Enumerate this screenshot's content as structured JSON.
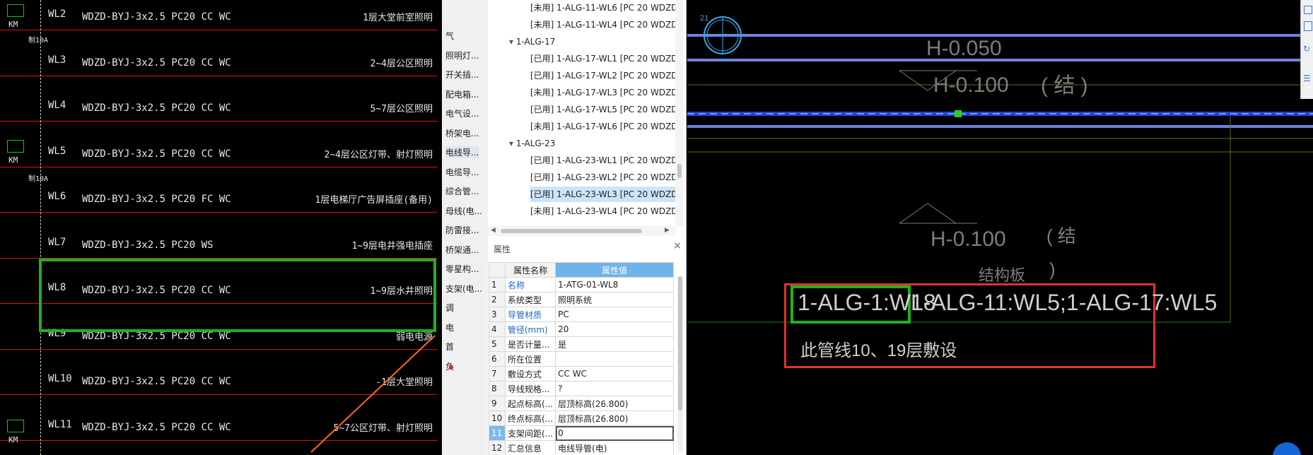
{
  "left_cad": {
    "circuits": [
      {
        "code": "WL2",
        "spec": "WDZD-BYJ-3x2.5 PC20 CC WC",
        "desc": "1层大堂前室照明"
      },
      {
        "code": "WL3",
        "spec": "WDZD-BYJ-3x2.5 PC20 CC WC",
        "desc": "2~4层公区照明"
      },
      {
        "code": "WL4",
        "spec": "WDZD-BYJ-3x2.5 PC20 CC WC",
        "desc": "5~7层公区照明"
      },
      {
        "code": "WL5",
        "spec": "WDZD-BYJ-3x2.5 PC20 CC WC",
        "desc": "2~4层公区灯带、射灯照明"
      },
      {
        "code": "WL6",
        "spec": "WDZD-BYJ-3x2.5 PC20 FC WC",
        "desc": "1层电梯厅广告屏插座(备用)"
      },
      {
        "code": "WL7",
        "spec": "WDZD-BYJ-3x2.5 PC20 WS",
        "desc": "1~9层电井强电插座"
      },
      {
        "code": "WL8",
        "spec": "WDZD-BYJ-3x2.5 PC20 CC WC",
        "desc": "1~9层水井照明"
      },
      {
        "code": "WL9",
        "spec": "WDZD-BYJ-3x2.5 PC20 CC WC",
        "desc": "弱电电源"
      },
      {
        "code": "WL10",
        "spec": "WDZD-BYJ-3x2.5 PC20 CC WC",
        "desc": "-1层大堂照明"
      },
      {
        "code": "WL11",
        "spec": "WDZD-BYJ-3x2.5 PC20 CC WC",
        "desc": "5~7公区灯带、射灯照明"
      }
    ],
    "km_label": "KM",
    "breaker_label": "制10A"
  },
  "categories": [
    "气",
    "照明灯...",
    "开关插...",
    "配电箱...",
    "电气设...",
    "桥架电...",
    "电线导...",
    "电缆导...",
    "综合管...",
    "母线(电...",
    "防雷接...",
    "桥架通...",
    "零星构...",
    "支架(电...",
    "调",
    "电",
    "首",
    "负"
  ],
  "tree": {
    "rows": [
      {
        "text": "[未用] 1-ALG-11-WL6 [PC 20 WDZD",
        "indent": 2
      },
      {
        "text": "[未用] 1-ALG-11-WL4 [PC 20 WDZD",
        "indent": 2
      },
      {
        "text": "1-ALG-17",
        "indent": 1,
        "group": true
      },
      {
        "text": "[已用] 1-ALG-17-WL1 [PC 20 WDZD",
        "indent": 2
      },
      {
        "text": "[已用] 1-ALG-17-WL2 [PC 20 WDZD",
        "indent": 2
      },
      {
        "text": "[未用] 1-ALG-17-WL3 [PC 20 WDZD",
        "indent": 2
      },
      {
        "text": "[已用] 1-ALG-17-WL5 [PC 20 WDZD",
        "indent": 2
      },
      {
        "text": "[未用] 1-ALG-17-WL6 [PC 20 WDZD",
        "indent": 2
      },
      {
        "text": "1-ALG-23",
        "indent": 1,
        "group": true
      },
      {
        "text": "[已用] 1-ALG-23-WL1 [PC 20 WDZD",
        "indent": 2
      },
      {
        "text": "[已用] 1-ALG-23-WL2 [PC 20 WDZD",
        "indent": 2
      },
      {
        "text": "[已用] 1-ALG-23-WL3 [PC 20 WDZD",
        "indent": 2,
        "selected": true
      },
      {
        "text": "[未用] 1-ALG-23-WL4 [PC 20 WDZD",
        "indent": 2
      }
    ]
  },
  "props": {
    "title": "属性",
    "header": [
      "属性名称",
      "属性值"
    ],
    "rows": [
      {
        "n": "1",
        "name": "名称",
        "value": "1-ATG-01-WL8",
        "blue": true
      },
      {
        "n": "2",
        "name": "系统类型",
        "value": "照明系统",
        "blue": false
      },
      {
        "n": "3",
        "name": "导管材质",
        "value": "PC",
        "blue": true
      },
      {
        "n": "4",
        "name": "管径(mm)",
        "value": "20",
        "blue": true
      },
      {
        "n": "5",
        "name": "是否计量...",
        "value": "是",
        "blue": false
      },
      {
        "n": "6",
        "name": "所在位置",
        "value": "",
        "blue": false
      },
      {
        "n": "7",
        "name": "敷设方式",
        "value": "CC WC",
        "blue": false
      },
      {
        "n": "8",
        "name": "导线规格...",
        "value": "?",
        "blue": false
      },
      {
        "n": "9",
        "name": "起点标高(...",
        "value": "层顶标高(26.800)",
        "blue": false
      },
      {
        "n": "10",
        "name": "终点标高(...",
        "value": "层顶标高(26.800)",
        "blue": false
      },
      {
        "n": "11",
        "name": "支架间距(...",
        "value": "0",
        "blue": false
      },
      {
        "n": "12",
        "name": "汇总信息",
        "value": "电线导管(电)",
        "blue": false
      }
    ]
  },
  "right_cad": {
    "axis_label": "21",
    "h1": "H-0.050",
    "h2": "H-0.100",
    "paren1": "( 结 )",
    "h3": "H-0.100",
    "paren2": "( 结",
    "paren2b": ")",
    "struct": "结构板",
    "label_main": "1-ALG-1:WL8",
    "label_rest": "1-ALG-11:WL5;1-ALG-17:WL5",
    "note": "此管线10、19层敷设"
  },
  "colors": {
    "cad_red": "#d11111",
    "highlight_green": "#1fb11f",
    "highlight_red": "#e53030",
    "select_blue": "#cde4f7"
  }
}
